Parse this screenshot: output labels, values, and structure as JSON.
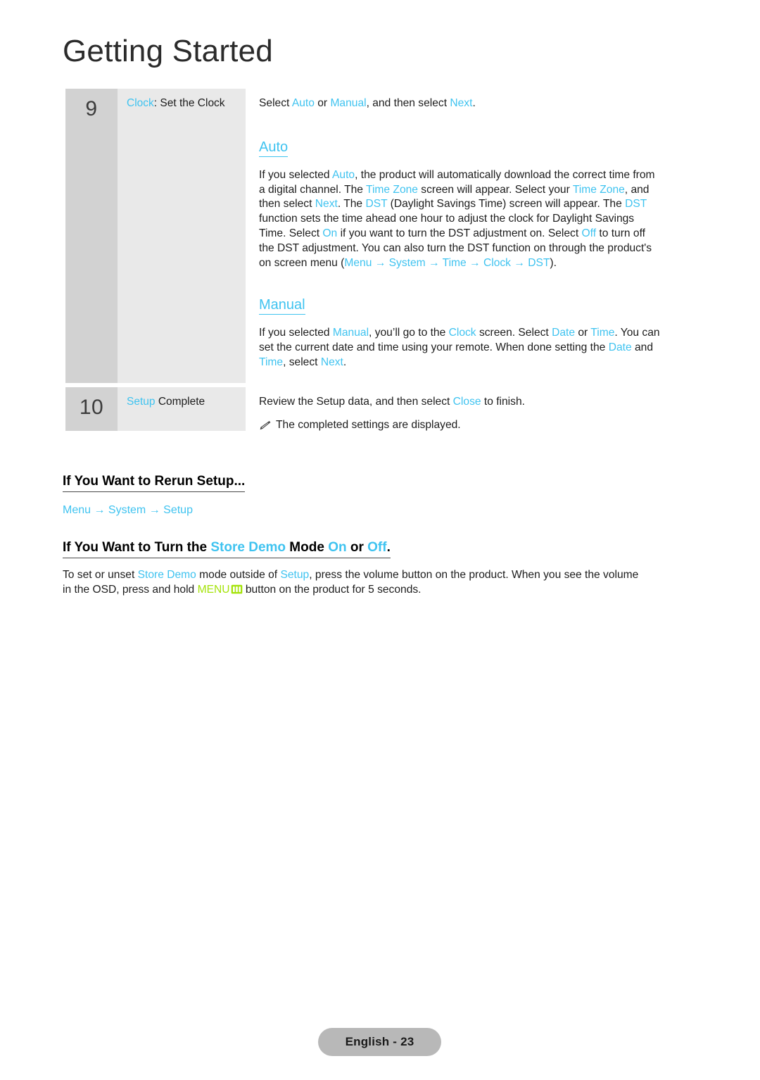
{
  "page": {
    "title": "Getting Started",
    "footer_label": "English - 23",
    "accent_color": "#3fc3f0",
    "menu_key_color": "#a4e309",
    "num_cell_bg": "#d2d2d2",
    "label_cell_bg": "#e9e9e9"
  },
  "steps": [
    {
      "number": "9",
      "label_accent": "Clock",
      "label_rest": ": Set the Clock",
      "intro": {
        "pre": "Select ",
        "a1": "Auto",
        "mid1": " or ",
        "a2": "Manual",
        "mid2": ", and then select ",
        "a3": "Next",
        "post": "."
      },
      "auto": {
        "heading": "Auto",
        "lines": [
          [
            {
              "t": "If you selected ",
              "c": "k"
            },
            {
              "t": "Auto",
              "c": "a"
            },
            {
              "t": ", the product will automatically download the correct time from",
              "c": "k"
            }
          ],
          [
            {
              "t": "a digital channel. The ",
              "c": "k"
            },
            {
              "t": "Time Zone",
              "c": "a"
            },
            {
              "t": " screen will appear. Select your ",
              "c": "k"
            },
            {
              "t": "Time Zone",
              "c": "a"
            },
            {
              "t": ", and",
              "c": "k"
            }
          ],
          [
            {
              "t": "then select ",
              "c": "k"
            },
            {
              "t": "Next",
              "c": "a"
            },
            {
              "t": ". The ",
              "c": "k"
            },
            {
              "t": "DST",
              "c": "a"
            },
            {
              "t": " (Daylight Savings Time) screen will appear. The ",
              "c": "k"
            },
            {
              "t": "DST",
              "c": "a"
            }
          ],
          [
            {
              "t": "function sets the time ahead one hour to adjust the clock for Daylight Savings",
              "c": "k"
            }
          ],
          [
            {
              "t": "Time. Select ",
              "c": "k"
            },
            {
              "t": "On",
              "c": "a"
            },
            {
              "t": " if you want to turn the DST adjustment on. Select ",
              "c": "k"
            },
            {
              "t": "Off",
              "c": "a"
            },
            {
              "t": " to turn off",
              "c": "k"
            }
          ],
          [
            {
              "t": "the DST adjustment. You can also turn the DST function on through the product's",
              "c": "k"
            }
          ],
          [
            {
              "t": "on screen menu (",
              "c": "k"
            },
            {
              "t": "Menu",
              "c": "a"
            },
            {
              "t": " → ",
              "c": "a"
            },
            {
              "t": "System",
              "c": "a"
            },
            {
              "t": " → ",
              "c": "a"
            },
            {
              "t": "Time",
              "c": "a"
            },
            {
              "t": " → ",
              "c": "a"
            },
            {
              "t": "Clock",
              "c": "a"
            },
            {
              "t": " → ",
              "c": "a"
            },
            {
              "t": "DST",
              "c": "a"
            },
            {
              "t": ").",
              "c": "k"
            }
          ]
        ]
      },
      "manual": {
        "heading": "Manual",
        "lines": [
          [
            {
              "t": "If you selected ",
              "c": "k"
            },
            {
              "t": "Manual",
              "c": "a"
            },
            {
              "t": ", you’ll go to the ",
              "c": "k"
            },
            {
              "t": "Clock",
              "c": "a"
            },
            {
              "t": " screen. Select ",
              "c": "k"
            },
            {
              "t": "Date",
              "c": "a"
            },
            {
              "t": " or ",
              "c": "k"
            },
            {
              "t": "Time",
              "c": "a"
            },
            {
              "t": ". You can",
              "c": "k"
            }
          ],
          [
            {
              "t": "set the current date and time using your remote. When done setting the ",
              "c": "k"
            },
            {
              "t": "Date",
              "c": "a"
            },
            {
              "t": " and",
              "c": "k"
            }
          ],
          [
            {
              "t": "Time",
              "c": "a"
            },
            {
              "t": ", select ",
              "c": "k"
            },
            {
              "t": "Next",
              "c": "a"
            },
            {
              "t": ".",
              "c": "k"
            }
          ]
        ]
      }
    },
    {
      "number": "10",
      "label_accent": "Setup",
      "label_rest": " Complete",
      "review": {
        "pre": "Review the Setup data, and then select ",
        "a1": "Close",
        "post": " to finish."
      },
      "note": "The completed settings are displayed."
    }
  ],
  "sections": [
    {
      "heading": "If You Want to Rerun Setup...",
      "path": "Menu → System → Setup"
    },
    {
      "heading_parts": [
        {
          "t": "If You Want to Turn the ",
          "c": "k"
        },
        {
          "t": "Store Demo",
          "c": "a"
        },
        {
          "t": " Mode ",
          "c": "k"
        },
        {
          "t": "On",
          "c": "a"
        },
        {
          "t": " or ",
          "c": "k"
        },
        {
          "t": "Off",
          "c": "a"
        },
        {
          "t": ".",
          "c": "k"
        }
      ],
      "body_lines": [
        [
          {
            "t": "To set or unset ",
            "c": "k"
          },
          {
            "t": "Store Demo",
            "c": "a"
          },
          {
            "t": " mode outside of ",
            "c": "k"
          },
          {
            "t": "Setup",
            "c": "a"
          },
          {
            "t": ", press the volume button on the product. When you see the volume",
            "c": "k"
          }
        ],
        [
          {
            "t": "in the OSD, press and hold ",
            "c": "k"
          },
          {
            "t": "MENU",
            "c": "m"
          },
          {
            "t": "GLYPH",
            "c": "g"
          },
          {
            "t": " button on the product for 5 seconds.",
            "c": "k"
          }
        ]
      ]
    }
  ]
}
